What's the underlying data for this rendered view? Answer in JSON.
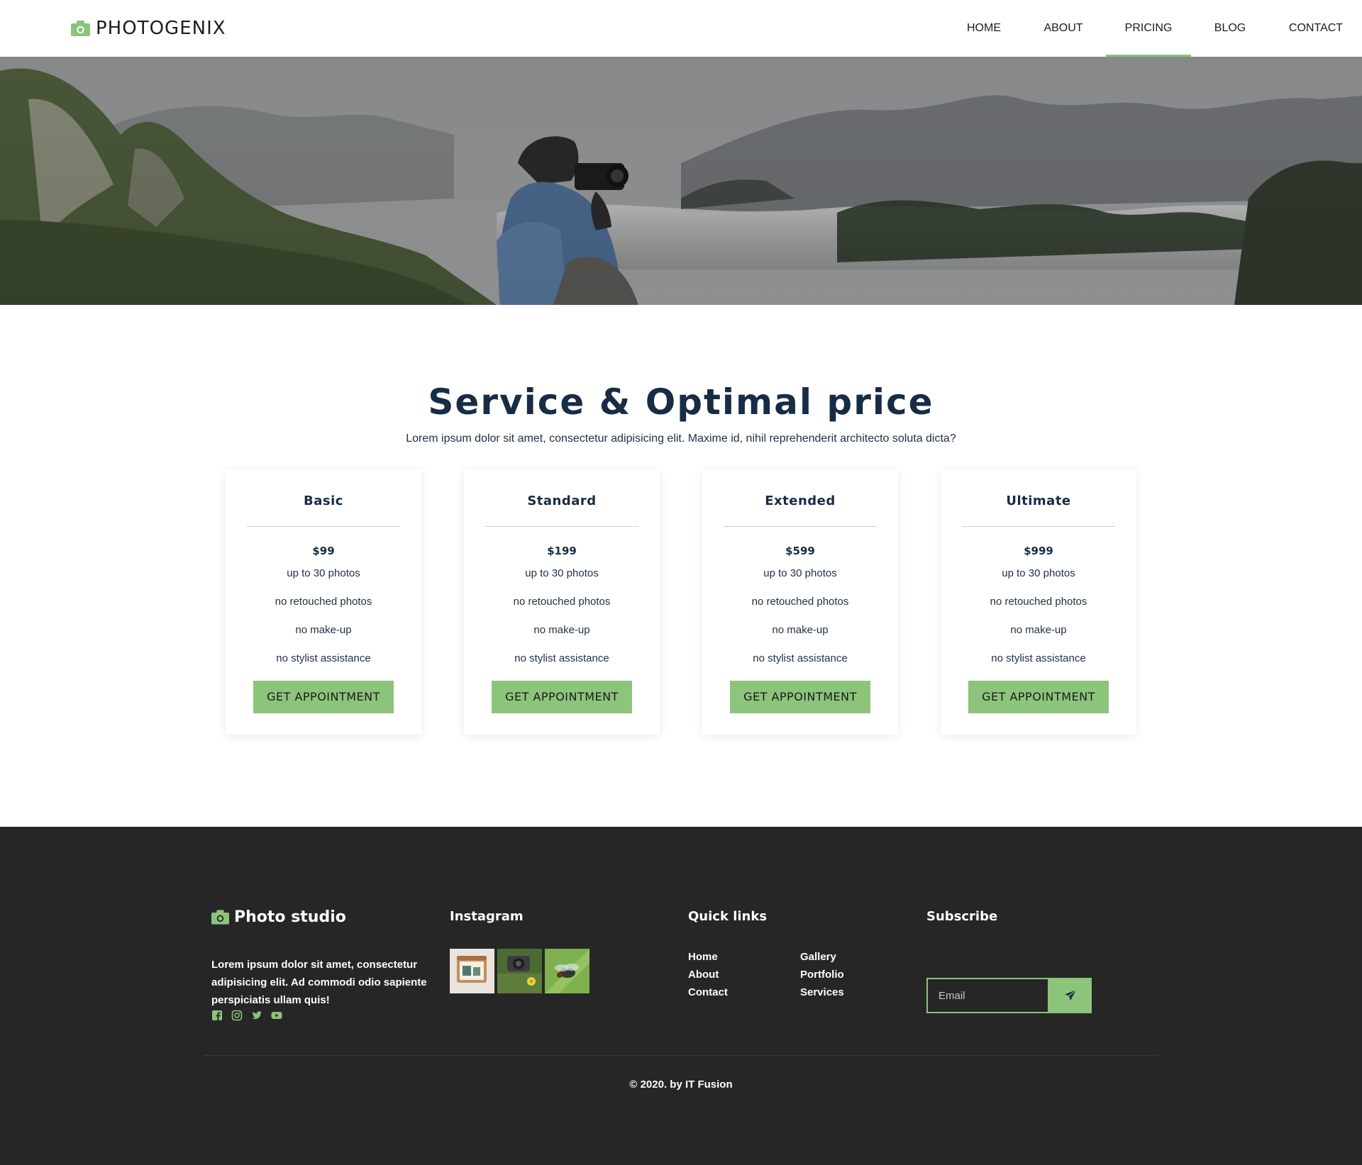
{
  "header": {
    "brand": "PHOTOGENIX",
    "nav": [
      {
        "label": "HOME"
      },
      {
        "label": "ABOUT"
      },
      {
        "label": "PRICING"
      },
      {
        "label": "BLOG"
      },
      {
        "label": "CONTACT"
      }
    ],
    "active_nav": "PRICING"
  },
  "pricing": {
    "title": "Service & Optimal price",
    "subtitle": "Lorem ipsum dolor sit amet, consectetur adipisicing elit. Maxime id, nihil reprehenderit architecto soluta dicta?",
    "plans": [
      {
        "name": "Basic",
        "price": "$99",
        "features": [
          "up to 30 photos",
          "no retouched photos",
          "no make-up",
          "no stylist assistance"
        ],
        "button": "GET APPOINTMENT"
      },
      {
        "name": "Standard",
        "price": "$199",
        "features": [
          "up to 30 photos",
          "no retouched photos",
          "no make-up",
          "no stylist assistance"
        ],
        "button": "GET APPOINTMENT"
      },
      {
        "name": "Extended",
        "price": "$599",
        "features": [
          "up to 30 photos",
          "no retouched photos",
          "no make-up",
          "no stylist assistance"
        ],
        "button": "GET APPOINTMENT"
      },
      {
        "name": "Ultimate",
        "price": "$999",
        "features": [
          "up to 30 photos",
          "no retouched photos",
          "no make-up",
          "no stylist assistance"
        ],
        "button": "GET APPOINTMENT"
      }
    ]
  },
  "footer": {
    "brand": "Photo studio",
    "description": "Lorem ipsum dolor sit amet, consectetur adipisicing elit. Ad commodi odio sapiente perspiciatis ullam quis!",
    "social_icons": [
      "facebook-icon",
      "instagram-icon",
      "twitter-icon",
      "youtube-icon"
    ],
    "instagram_title": "Instagram",
    "quick_links_title": "Quick links",
    "quick_links": {
      "col1": [
        "Home",
        "About",
        "Contact"
      ],
      "col2": [
        "Gallery",
        "Portfolio",
        "Services"
      ]
    },
    "subscribe_title": "Subscribe",
    "email_placeholder": "Email",
    "copyright": "© 2020. by IT Fusion"
  },
  "colors": {
    "accent": "#8dc47b",
    "heading": "#172c45",
    "footer_bg": "#262626"
  }
}
